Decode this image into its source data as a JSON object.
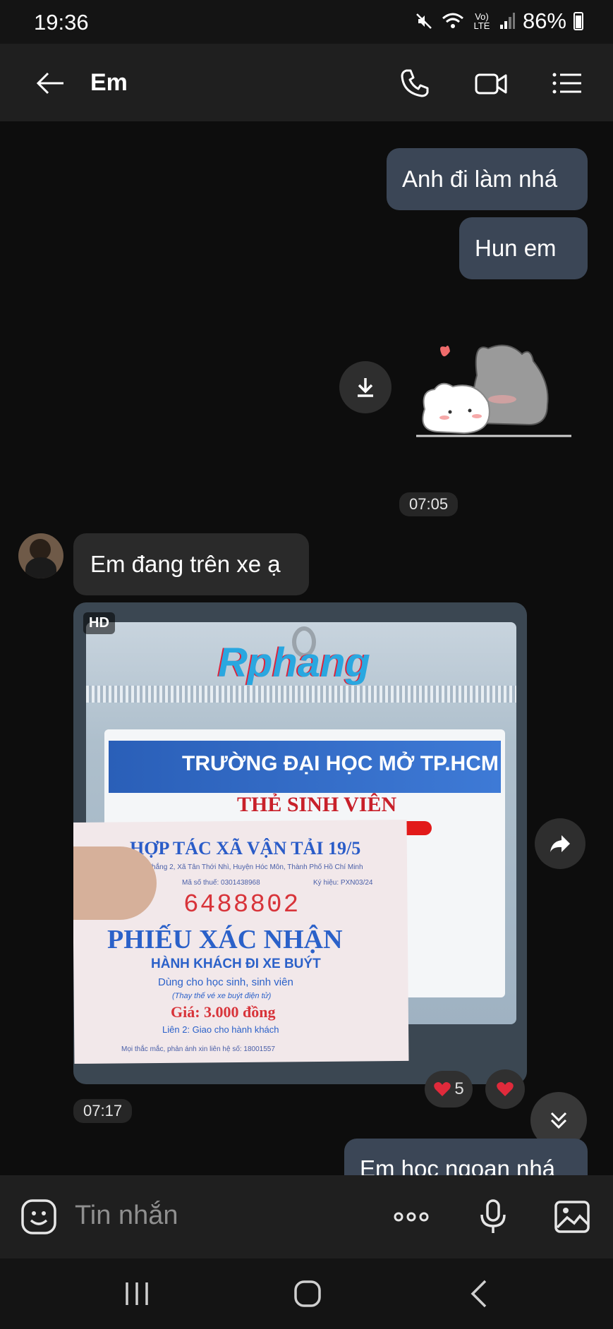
{
  "status_bar": {
    "time": "19:36",
    "battery": "86%",
    "network": "Vo) LTE"
  },
  "header": {
    "contact_name": "Em"
  },
  "messages": {
    "out_1": "Anh đi làm nhá",
    "out_2": "Hun em",
    "time_1": "07:05",
    "in_1": "Em đang trên xe ạ",
    "photo_badge": "HD",
    "photo_watermark": "Rphang",
    "reaction_count": "5",
    "time_2": "07:17",
    "out_3": "Em học ngoan nhá"
  },
  "photo_content": {
    "card_school": "TRƯỜNG ĐẠI HỌC MỞ TP.HCM",
    "card_title": "THẺ SINH VIÊN",
    "ticket_company": "HỢP TÁC XÃ VẬN TẢI 19/5",
    "ticket_address": "Dân Thắng 2, Xã Tân Thới Nhì, Huyện Hóc Môn, Thành Phố Hồ Chí Minh",
    "ticket_tax": "Mã số thuế: 0301438968",
    "ticket_symbol": "Ký hiệu: PXN03/24",
    "ticket_number": "6488802",
    "ticket_title": "PHIẾU XÁC NHẬN",
    "ticket_subtitle": "HÀNH KHÁCH ĐI XE BUÝT",
    "ticket_use": "Dùng cho học sinh, sinh viên",
    "ticket_note": "(Thay thế vé xe buýt điện tử)",
    "ticket_price": "Giá: 3.000 đồng",
    "ticket_copy": "Liên 2: Giao cho hành khách",
    "ticket_hotline": "Mọi thắc mắc, phản ánh xin liên hệ số: 18001557"
  },
  "composer": {
    "placeholder": "Tin nhắn"
  },
  "colors": {
    "outgoing_bubble": "#3b4656",
    "incoming_bubble": "#2a2a2a",
    "background": "#0d0d0d",
    "header": "#1f1f1f"
  }
}
